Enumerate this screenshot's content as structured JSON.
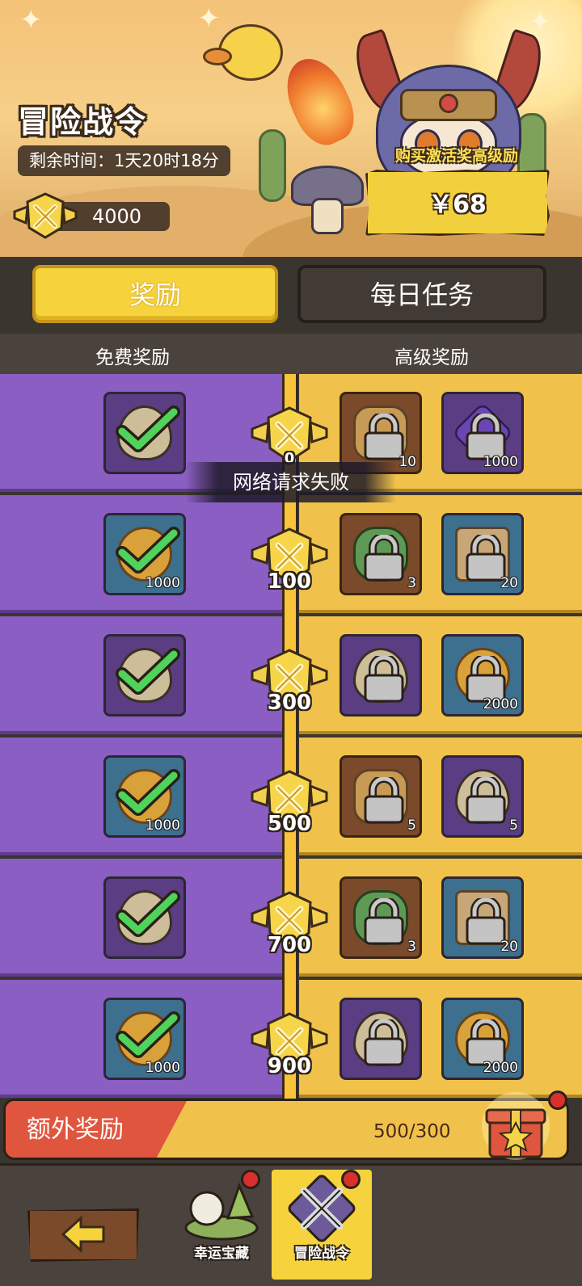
{
  "header": {
    "title": "冒险战令",
    "time_remaining": "剩余时间：1天20时18分",
    "currency_amount": "4000",
    "buy_caption": "购买激活奖高级励",
    "buy_price": "￥68"
  },
  "tabs": [
    {
      "label": "奖励",
      "active": true
    },
    {
      "label": "每日任务",
      "active": false
    }
  ],
  "columns": {
    "free": "免费奖励",
    "premium": "高级奖励"
  },
  "rows": [
    {
      "level": "0",
      "free": {
        "icon": "egg",
        "qty": "",
        "claimed": true
      },
      "premium": [
        {
          "icon": "dragon",
          "qty": "10",
          "locked": true
        },
        {
          "icon": "gem",
          "qty": "1000",
          "locked": true
        }
      ]
    },
    {
      "level": "100",
      "free": {
        "icon": "coin",
        "qty": "1000",
        "claimed": true
      },
      "premium": [
        {
          "icon": "clover",
          "qty": "3",
          "locked": true
        },
        {
          "icon": "scroll",
          "qty": "20",
          "locked": true
        }
      ]
    },
    {
      "level": "300",
      "free": {
        "icon": "egg",
        "qty": "",
        "claimed": true
      },
      "premium": [
        {
          "icon": "egg",
          "qty": "",
          "locked": true
        },
        {
          "icon": "coin",
          "qty": "2000",
          "locked": true
        }
      ]
    },
    {
      "level": "500",
      "free": {
        "icon": "coin",
        "qty": "1000",
        "claimed": true
      },
      "premium": [
        {
          "icon": "dragon",
          "qty": "5",
          "locked": true
        },
        {
          "icon": "egg",
          "qty": "5",
          "locked": true
        }
      ]
    },
    {
      "level": "700",
      "free": {
        "icon": "egg",
        "qty": "",
        "claimed": true
      },
      "premium": [
        {
          "icon": "clover",
          "qty": "3",
          "locked": true
        },
        {
          "icon": "scroll",
          "qty": "20",
          "locked": true
        }
      ]
    },
    {
      "level": "900",
      "free": {
        "icon": "coin",
        "qty": "1000",
        "claimed": true
      },
      "premium": [
        {
          "icon": "egg",
          "qty": "",
          "locked": true
        },
        {
          "icon": "coin",
          "qty": "2000",
          "locked": true
        }
      ]
    }
  ],
  "toast": "网络请求失败",
  "extra_reward": {
    "label": "额外奖励",
    "progress": "500/300"
  },
  "bottom_nav": [
    {
      "label": "幸运宝藏",
      "active": false,
      "has_badge": true
    },
    {
      "label": "冒险战令",
      "active": true,
      "has_badge": true
    }
  ],
  "colors": {
    "free_bg": "#8a5ec2",
    "premium_bg": "#f1c24b",
    "accent_yellow": "#f6d33d",
    "extra_red": "#e0553e"
  }
}
